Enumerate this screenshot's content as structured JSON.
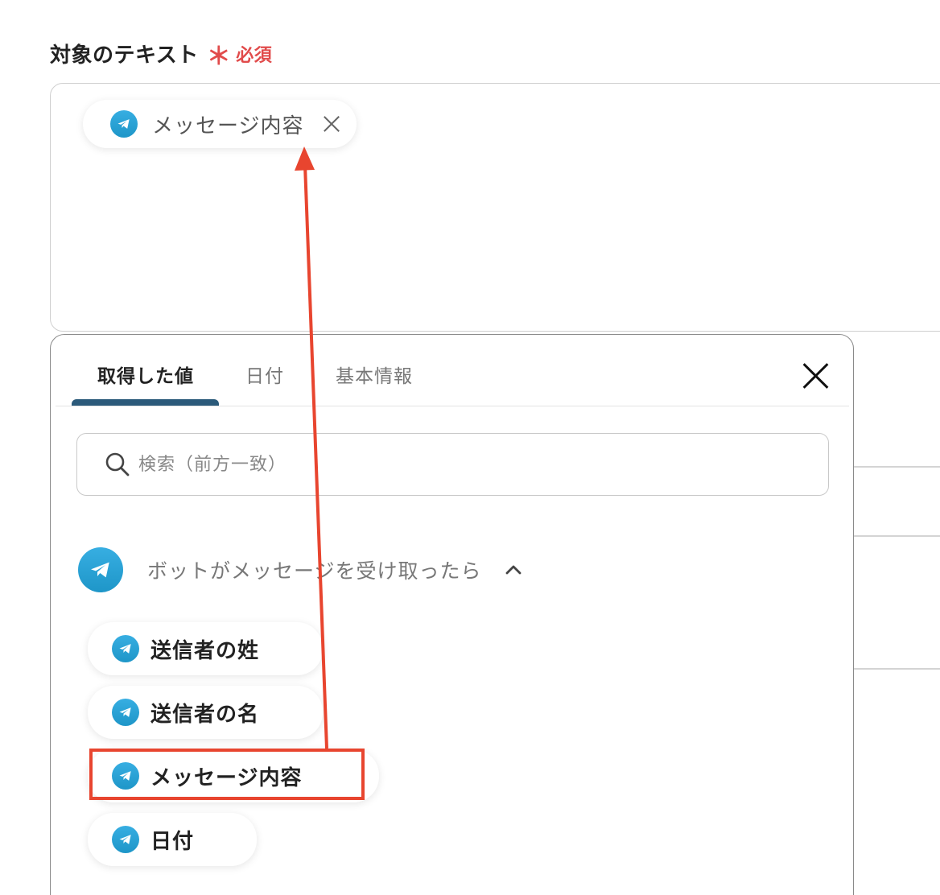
{
  "field": {
    "label": "対象のテキスト",
    "required_star": "＊",
    "required_text": "必須",
    "required_color": "#e14b4b",
    "chip": {
      "label": "メッセージ内容",
      "icon": "telegram-icon"
    }
  },
  "panel": {
    "tabs": [
      {
        "label": "取得した値",
        "active": true
      },
      {
        "label": "日付",
        "active": false
      },
      {
        "label": "基本情報",
        "active": false
      }
    ],
    "search": {
      "placeholder": "検索（前方一致）"
    },
    "group": {
      "title": "ボットがメッセージを受け取ったら",
      "icon": "telegram-icon",
      "expanded": true
    },
    "items": [
      {
        "label": "送信者の姓",
        "icon": "telegram-icon"
      },
      {
        "label": "送信者の名",
        "icon": "telegram-icon"
      },
      {
        "label": "メッセージ内容",
        "icon": "telegram-icon",
        "highlighted": true
      },
      {
        "label": "日付",
        "icon": "telegram-icon"
      }
    ]
  },
  "colors": {
    "accent_tab": "#2b5a7a",
    "annotation": "#e8452f",
    "telegram": "#2aa3d8"
  }
}
